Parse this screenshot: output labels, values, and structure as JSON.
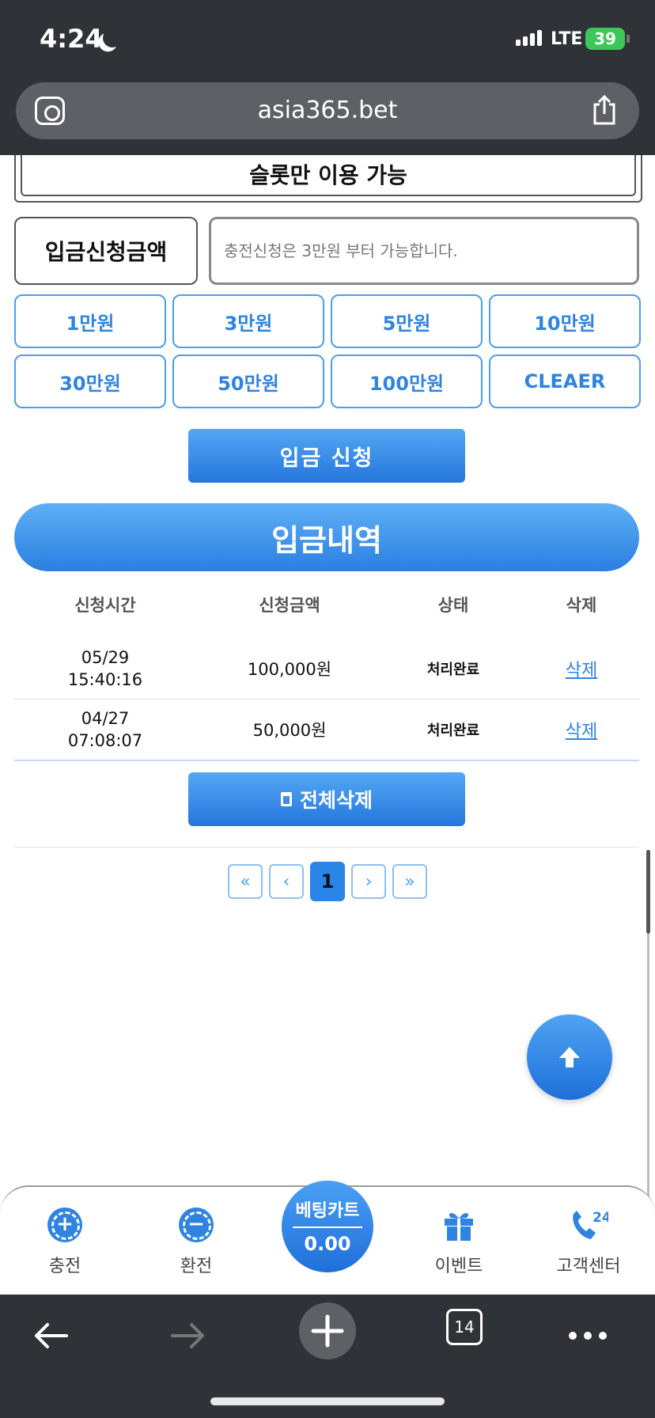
{
  "status_bar": {
    "time": "4:24",
    "network": "LTE",
    "battery": "39"
  },
  "browser": {
    "url": "asia365.bet",
    "tab_count": "14"
  },
  "notice": {
    "slot_only": "슬롯만 이용 가능"
  },
  "deposit_form": {
    "amount_label": "입금신청금액",
    "amount_placeholder": "충전신청은 3만원 부터 가능합니다.",
    "amount_buttons": [
      "1만원",
      "3만원",
      "5만원",
      "10만원",
      "30만원",
      "50만원",
      "100만원",
      "CLEAER"
    ],
    "submit_label": "입금 신청"
  },
  "history": {
    "title": "입금내역",
    "columns": [
      "신청시간",
      "신청금액",
      "상태",
      "삭제"
    ],
    "rows": [
      {
        "date": "05/29",
        "time": "15:40:16",
        "amount": "100,000원",
        "status": "처리완료",
        "delete": "삭제"
      },
      {
        "date": "04/27",
        "time": "07:08:07",
        "amount": "50,000원",
        "status": "처리완료",
        "delete": "삭제"
      }
    ],
    "delete_all_label": "전체삭제"
  },
  "pagination": {
    "first": "«",
    "prev": "‹",
    "current": "1",
    "next": "›",
    "last": "»"
  },
  "bottom_nav": {
    "charge": "충전",
    "exchange": "환전",
    "bet_cart_label": "베팅카트",
    "bet_cart_value": "0.00",
    "event": "이벤트",
    "support": "고객센터",
    "support_badge": "24"
  },
  "colors": {
    "accent": "#2f84e0",
    "topbar": "#2f3236",
    "battery": "#3cc75b"
  }
}
